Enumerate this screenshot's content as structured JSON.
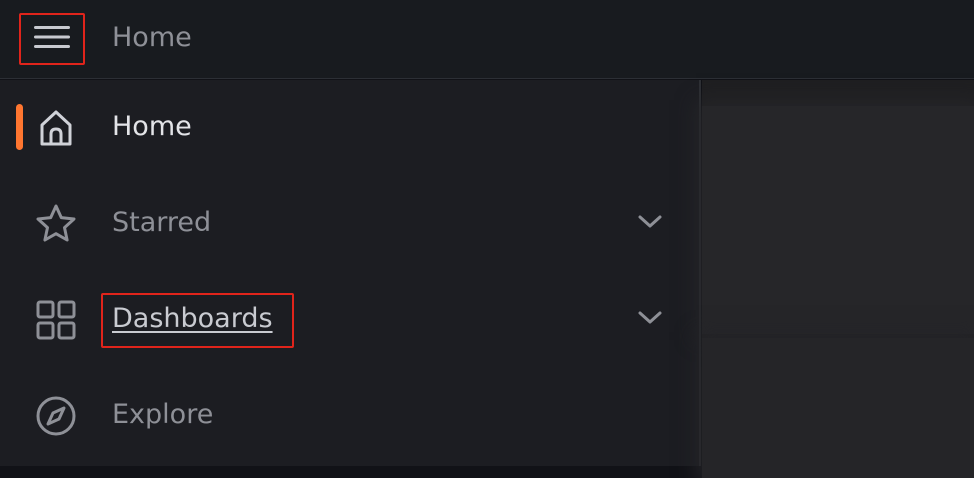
{
  "topbar": {
    "menu_icon": "hamburger-menu-icon",
    "breadcrumb": "Home"
  },
  "sidebar": {
    "items": [
      {
        "label": "Home",
        "icon": "home-icon",
        "active": true,
        "expandable": false
      },
      {
        "label": "Starred",
        "icon": "star-icon",
        "active": false,
        "expandable": true
      },
      {
        "label": "Dashboards",
        "icon": "apps-grid-icon",
        "active": false,
        "expandable": true
      },
      {
        "label": "Explore",
        "icon": "compass-icon",
        "active": false,
        "expandable": false
      }
    ]
  },
  "colors": {
    "accent": "#ff7630",
    "highlight_box": "#e0241b",
    "text_active": "#e3e4e8",
    "text_muted": "#8e9097"
  }
}
